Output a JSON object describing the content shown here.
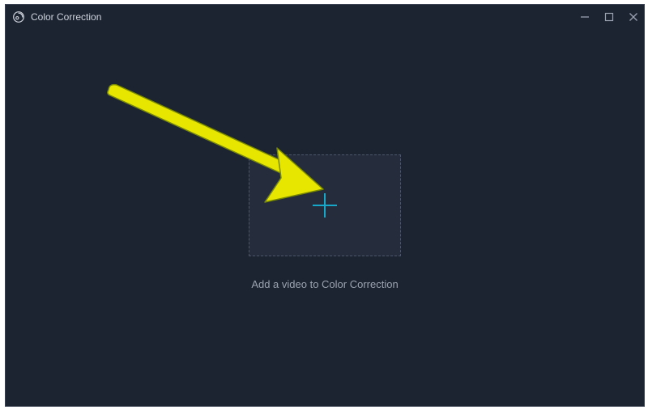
{
  "window": {
    "title": "Color Correction"
  },
  "main": {
    "caption": "Add a video to Color Correction"
  },
  "icons": {
    "app": "app-logo-icon",
    "minimize": "minimize-icon",
    "maximize": "maximize-icon",
    "close": "close-icon",
    "plus": "plus-icon"
  },
  "colors": {
    "background": "#1c2331",
    "dropzone_bg": "#252d3c",
    "dropzone_border": "#4c566a",
    "accent_plus": "#17a7c9",
    "text_muted": "#9ba2b0",
    "annotation_arrow": "#e7e600"
  }
}
